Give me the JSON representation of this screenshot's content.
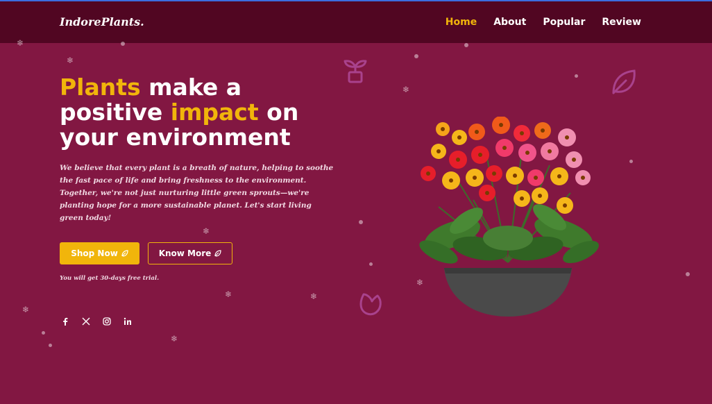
{
  "colors": {
    "background": "#821742",
    "navbar": "#510622",
    "accent": "#f1b50b",
    "text": "#ffffff"
  },
  "nav": {
    "logo": "IndorePlants.",
    "links": [
      {
        "label": "Home",
        "active": true
      },
      {
        "label": "About",
        "active": false
      },
      {
        "label": "Popular",
        "active": false
      },
      {
        "label": "Review",
        "active": false
      }
    ]
  },
  "hero": {
    "headline": {
      "part1": "Plants",
      "part2": " make a positive ",
      "part3": "impact",
      "part4": " on your environment"
    },
    "description": "We believe that every plant is a breath of nature, helping to soothe the fast pace of life and bring freshness to the environment. Together, we're not just nurturing little green sprouts—we're planting hope for a more sustainable planet. Let's start living green today!",
    "primary_button": "Shop Now",
    "secondary_button": "Know More",
    "button_icon": "leaf-icon",
    "trial_note": "You will get 30-days free trial.",
    "image": "potted-gerbera-flowers"
  },
  "socials": [
    "facebook-icon",
    "x-icon",
    "instagram-icon",
    "linkedin-icon"
  ],
  "decorations": [
    "plant-pot-icon",
    "leaf-outline-icon",
    "tulip-outline-icon",
    "snowflake-icon"
  ]
}
